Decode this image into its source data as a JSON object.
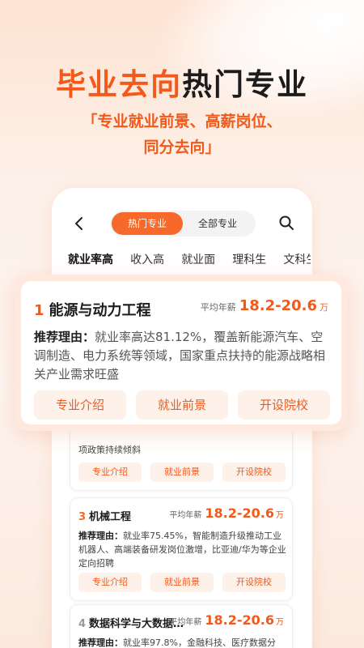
{
  "headline": {
    "part1": "毕业去向",
    "part2": "热门专业"
  },
  "subline": {
    "line1": "「专业就业前景、高薪岗位、",
    "line2": "同分去向」"
  },
  "topbar": {
    "seg_active": "热门专业",
    "seg_inactive": "全部专业"
  },
  "tabs": [
    "就业率高",
    "收入高",
    "就业面",
    "理科生",
    "文科生"
  ],
  "salary_label": "平均年薪",
  "salary_unit": "万",
  "reason_label": "推荐理由：",
  "buttons": {
    "intro": "专业介绍",
    "prospect": "就业前景",
    "schools": "开设院校"
  },
  "featured": {
    "num": "1",
    "name": "能源与动力工程",
    "salary": "18.2-20.6",
    "reason": "就业率高达81.12%，覆盖新能源汽车、空调制造、电力系统等领域，国家重点扶持的能源战略相关产业需求旺盛"
  },
  "card2": {
    "tail": "项政策持续倾斜"
  },
  "card3": {
    "num": "3",
    "name": "机械工程",
    "salary": "18.2-20.6",
    "reason": "就业率75.45%，智能制造升级推动工业机器人、高端装备研发岗位激增，比亚迪/华为等企业定向招聘"
  },
  "card4": {
    "num": "4",
    "name": "数据科学与大数据…",
    "salary": "18.2-20.6",
    "reason": "就业率97.8%，金融科技、医疗数据分"
  },
  "colors": {
    "accent": "#f25a1b",
    "accent_light": "#fef1ea"
  }
}
